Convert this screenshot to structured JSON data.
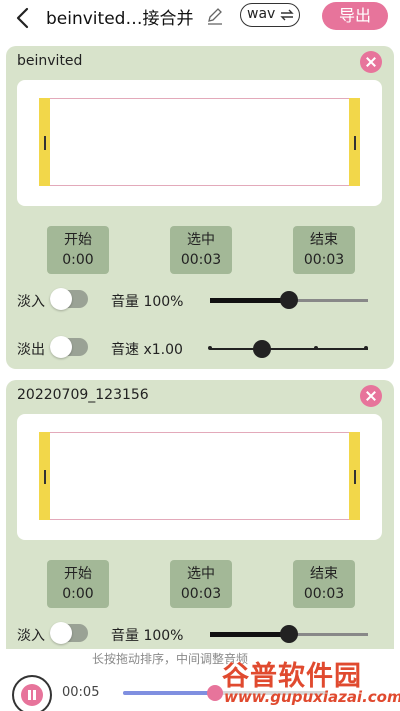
{
  "header": {
    "title": "beinvited…接合并",
    "format": "wav",
    "export_label": "导出"
  },
  "tracks": [
    {
      "name": "beinvited",
      "start_label": "开始",
      "start_time": "0:00",
      "selected_label": "选中",
      "selected_time": "00:03",
      "end_label": "结束",
      "end_time": "00:03",
      "fade_in_label": "淡入",
      "fade_out_label": "淡出",
      "volume_label": "音量 100%",
      "volume_level": 0.5,
      "speed_label": "音速 x1.00",
      "speed_level": 0.33
    },
    {
      "name": "20220709_123156",
      "start_label": "开始",
      "start_time": "0:00",
      "selected_label": "选中",
      "selected_time": "00:03",
      "end_label": "结束",
      "end_time": "00:03",
      "fade_in_label": "淡入",
      "volume_label": "音量 100%",
      "volume_level": 0.5
    }
  ],
  "footer": {
    "hint": "长按拖动排序，中间调整音频",
    "current_time": "00:05",
    "progress": 0.45
  },
  "watermark": {
    "name": "谷普软件园",
    "url": "www.gupuxiazai.com"
  },
  "colors": {
    "accent": "#e7749b",
    "card_bg": "#d8e3cb",
    "handle": "#f2d74a",
    "time_button": "#a3b897"
  }
}
